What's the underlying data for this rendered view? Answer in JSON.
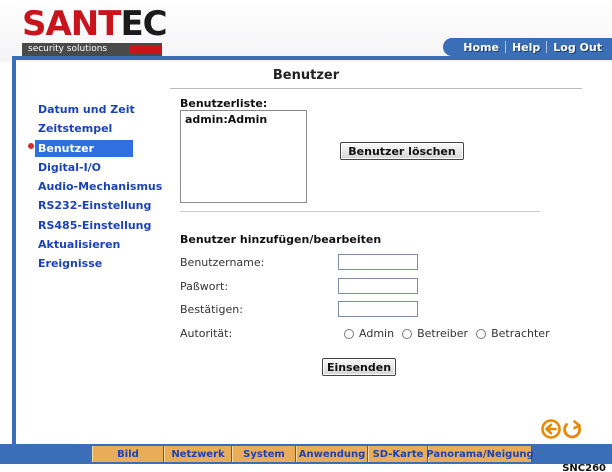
{
  "brand": {
    "name_red": "SANT",
    "name_dark": "EC",
    "tagline": "security solutions"
  },
  "topnav": {
    "home": "Home",
    "help": "Help",
    "logout": "Log Out"
  },
  "page": {
    "title": "Benutzer"
  },
  "sidebar": {
    "items": [
      {
        "label": "Datum und Zeit",
        "active": false
      },
      {
        "label": "Zeitstempel",
        "active": false
      },
      {
        "label": "Benutzer",
        "active": true
      },
      {
        "label": "Digital-I/O",
        "active": false
      },
      {
        "label": "Audio-Mechanismus",
        "active": false
      },
      {
        "label": "RS232-Einstellung",
        "active": false
      },
      {
        "label": "RS485-Einstellung",
        "active": false
      },
      {
        "label": "Aktualisieren",
        "active": false
      },
      {
        "label": "Ereignisse",
        "active": false
      }
    ]
  },
  "userlist": {
    "label": "Benutzerliste:",
    "entries": [
      "admin:Admin"
    ],
    "delete_button": "Benutzer löschen"
  },
  "form": {
    "heading": "Benutzer hinzufügen/bearbeiten",
    "username_label": "Benutzername:",
    "username_value": "",
    "password_label": "Paßwort:",
    "password_value": "",
    "confirm_label": "Bestätigen:",
    "confirm_value": "",
    "authority_label": "Autorität:",
    "authority_options": [
      "Admin",
      "Betreiber",
      "Betrachter"
    ],
    "submit_button": "Einsenden"
  },
  "bottomnav": {
    "tabs": [
      "Bild",
      "Netzwerk",
      "System",
      "Anwendung",
      "SD-Karte",
      "Panorama/Neigung"
    ]
  },
  "model": "SNC260",
  "colors": {
    "brand_red": "#c8141c",
    "frame_blue": "#3a6fb8",
    "link_blue": "#1b43b8",
    "tab_orange": "#e8ad56",
    "nav_icon_orange": "#e88a00"
  },
  "icons": {
    "back": "arrow-left-circle-icon",
    "refresh": "refresh-icon"
  }
}
